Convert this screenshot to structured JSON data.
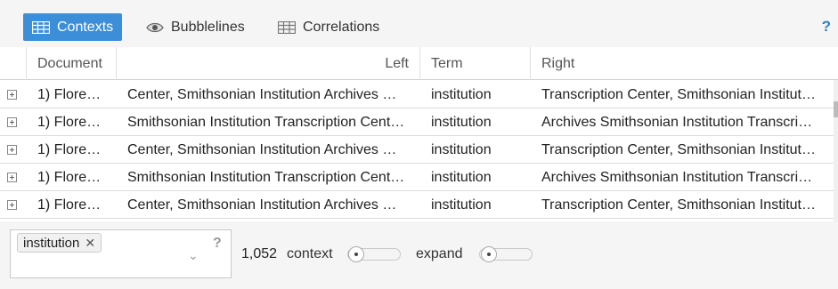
{
  "tabs": [
    {
      "label": "Contexts",
      "icon": "table-icon",
      "active": true
    },
    {
      "label": "Bubblelines",
      "icon": "eye-icon",
      "active": false
    },
    {
      "label": "Correlations",
      "icon": "table-icon",
      "active": false
    }
  ],
  "help": "?",
  "columns": {
    "document": "Document",
    "left": "Left",
    "term": "Term",
    "right": "Right"
  },
  "rows": [
    {
      "document": "1) Flore…",
      "left": "Center, Smithsonian Institution Archives …",
      "term": "institution",
      "right": "Transcription Center, Smithsonian Institut…"
    },
    {
      "document": "1) Flore…",
      "left": "Smithsonian Institution Transcription Cent…",
      "term": "institution",
      "right": "Archives Smithsonian Institution Transcri…"
    },
    {
      "document": "1) Flore…",
      "left": "Center, Smithsonian Institution Archives …",
      "term": "institution",
      "right": "Transcription Center, Smithsonian Institut…"
    },
    {
      "document": "1) Flore…",
      "left": "Smithsonian Institution Transcription Cent…",
      "term": "institution",
      "right": "Archives Smithsonian Institution Transcri…"
    },
    {
      "document": "1) Flore…",
      "left": "Center, Smithsonian Institution Archives …",
      "term": "institution",
      "right": "Transcription Center, Smithsonian Institut…"
    }
  ],
  "footer": {
    "query_token": "institution",
    "token_remove": "✕",
    "dropdown": "⌄",
    "help": "?",
    "count": "1,052",
    "context_label": "context",
    "expand_label": "expand"
  },
  "colors": {
    "accent": "#3d8ed8",
    "help": "#2a7fd0"
  }
}
